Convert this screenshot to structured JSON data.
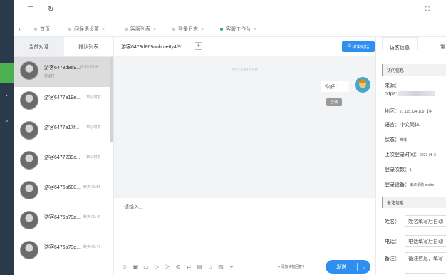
{
  "tabs": [
    {
      "label": "首页",
      "active": false
    },
    {
      "label": "问候语设置",
      "active": false
    },
    {
      "label": "客服列表",
      "active": false
    },
    {
      "label": "登录日志",
      "active": false
    },
    {
      "label": "客服工作台",
      "active": true
    }
  ],
  "conversation_tabs": {
    "current": "当前对话",
    "queue": "排队列表"
  },
  "conversations": [
    {
      "name": "游客6473d869...",
      "time": "05-29 10:34",
      "message": "你好！"
    },
    {
      "name": "游客6477a19e...",
      "time": "10小时前",
      "message": ""
    },
    {
      "name": "游客6477a17f...",
      "time": "10小时前",
      "message": ""
    },
    {
      "name": "游客6477239c...",
      "time": "10小时前",
      "message": ""
    },
    {
      "name": "游客6476a608...",
      "time": "昨天 09:51",
      "message": ""
    },
    {
      "name": "游客6476a79a...",
      "time": "昨天 09:49",
      "message": ""
    },
    {
      "name": "游客6476a73d...",
      "time": "昨天 09:47",
      "message": ""
    }
  ],
  "chat": {
    "title": "游客6473d869anbme6y4f91",
    "end_button": "结束对话",
    "timestamp": "2023-5-29 10:33",
    "message": "你好！",
    "read_label": "已读",
    "input_placeholder": "请输入...",
    "quick_reply": "添加快捷回复？",
    "send_label": "发送"
  },
  "visitor": {
    "tab_info": "访客信息",
    "tab_other": "常",
    "section_access": "访问信息",
    "source_label": "来源：",
    "source_value": "https:",
    "region_label": "地区：",
    "region_value": "27.115.124.109 【中",
    "language_label": "语言：",
    "language_value": "中文简体",
    "status_label": "状态：",
    "status_value": "离线",
    "last_login_label": "上次登录时间：",
    "last_login_value": "2023-05-2",
    "login_count_label": "登录次数：",
    "login_count_value": "1",
    "device_label": "登录设备：",
    "device_value": "安卓系统 andro",
    "section_note": "备注信息",
    "name_label": "姓名：",
    "name_placeholder": "姓名填写后自动",
    "phone_label": "电话：",
    "phone_placeholder": "电话填写后自动",
    "note_label": "备注：",
    "note_placeholder": "备注信息，填写"
  },
  "colors": {
    "accent": "#2f8ff0",
    "rail": "#2b3a4a",
    "rail_active": "#4caf50"
  }
}
